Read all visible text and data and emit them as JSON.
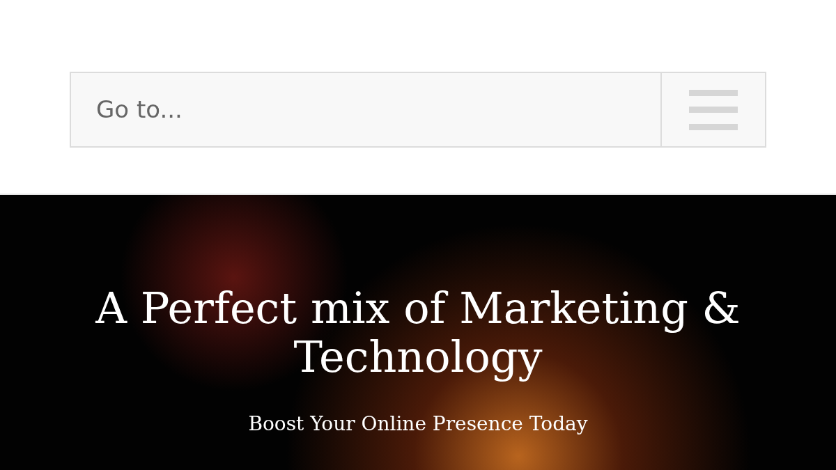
{
  "navigation": {
    "label": "Go to..."
  },
  "hero": {
    "title": "A Perfect mix of Marketing & Technology",
    "subtitle": "Boost Your Online Presence Today"
  }
}
